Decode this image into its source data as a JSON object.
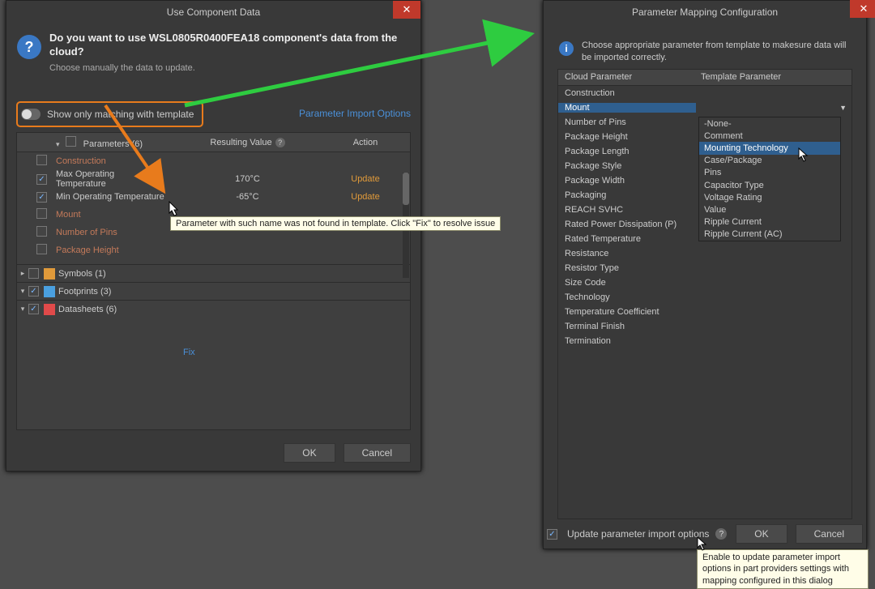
{
  "left": {
    "title": "Use Component Data",
    "question": "Do you want to use WSL0805R0400FEA18 component's data from the cloud?",
    "subtitle": "Choose manually the data to update.",
    "toggle_label": "Show only matching with template",
    "import_link": "Parameter Import Options",
    "grid_head": {
      "params": "Parameters (6)",
      "value": "Resulting Value",
      "action": "Action"
    },
    "rows": [
      {
        "name": "Construction",
        "bad": true,
        "checked": false,
        "val": "",
        "act": ""
      },
      {
        "name": "Max Operating Temperature",
        "bad": false,
        "checked": true,
        "val": "170°C",
        "act": "Update"
      },
      {
        "name": "Min Operating Temperature",
        "bad": false,
        "checked": true,
        "val": "-65°C",
        "act": "Update"
      },
      {
        "name": "Mount",
        "bad": true,
        "checked": false,
        "val": "",
        "act": ""
      },
      {
        "name": "Number of Pins",
        "bad": true,
        "checked": false,
        "val": "",
        "act": ""
      },
      {
        "name": "Package Height",
        "bad": true,
        "checked": false,
        "val": "",
        "act": ""
      }
    ],
    "fix_label": "Fix",
    "groups": {
      "symbols": "Symbols (1)",
      "footprints": "Footprints (3)",
      "datasheets": "Datasheets (6)"
    },
    "ok": "OK",
    "cancel": "Cancel",
    "tooltip_fix": "Parameter with such name was not found in template. Click \"Fix\" to resolve issue"
  },
  "right": {
    "title": "Parameter Mapping Configuration",
    "info": "Choose appropriate parameter from template to makesure data will be imported correctly.",
    "col1": "Cloud Parameter",
    "col2": "Template Parameter",
    "cloud_params": [
      "Construction",
      "Mount",
      "Number of Pins",
      "Package Height",
      "Package Length",
      "Package Style",
      "Package Width",
      "Packaging",
      "REACH SVHC",
      "Rated Power Dissipation (P)",
      "Rated Temperature",
      "Resistance",
      "Resistor Type",
      "Size Code",
      "Technology",
      "Temperature Coefficient",
      "Terminal Finish",
      "Termination"
    ],
    "selected_cloud": "Mount",
    "dropdown": [
      "-None-",
      "Comment",
      "Mounting Technology",
      "Case/Package",
      "Pins",
      "Capacitor Type",
      "Voltage Rating",
      "Value",
      "Ripple Current",
      "Ripple Current (AC)"
    ],
    "dropdown_selected": "Mounting Technology",
    "update_opts": "Update parameter import options",
    "ok": "OK",
    "cancel": "Cancel",
    "tooltip_update": "Enable to update parameter import options in part providers settings with mapping configured in this dialog"
  }
}
